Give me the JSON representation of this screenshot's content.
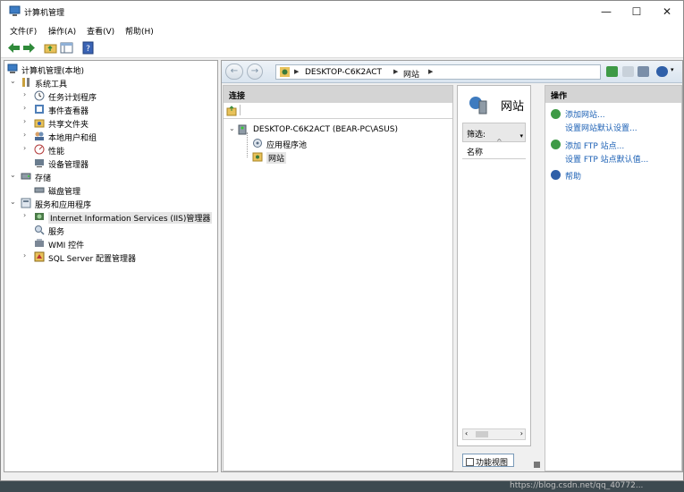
{
  "window": {
    "title": "计算机管理",
    "controls": [
      "—",
      "☐",
      "✕"
    ]
  },
  "menu": [
    "文件(F)",
    "操作(A)",
    "查看(V)",
    "帮助(H)"
  ],
  "tree": [
    {
      "label": "计算机管理(本地)"
    },
    {
      "label": "系统工具"
    },
    {
      "label": "任务计划程序"
    },
    {
      "label": "事件查看器"
    },
    {
      "label": "共享文件夹"
    },
    {
      "label": "本地用户和组"
    },
    {
      "label": "性能"
    },
    {
      "label": "设备管理器"
    },
    {
      "label": "存储"
    },
    {
      "label": "磁盘管理"
    },
    {
      "label": "服务和应用程序"
    },
    {
      "label": "Internet Information Services (IIS)管理器"
    },
    {
      "label": "服务"
    },
    {
      "label": "WMI 控件"
    },
    {
      "label": "SQL Server 配置管理器"
    }
  ],
  "iis": {
    "address": {
      "host": "DESKTOP-C6K2ACT",
      "section": "网站"
    },
    "connections": {
      "title": "连接",
      "server": "DESKTOP-C6K2ACT (BEAR-PC\\ASUS)",
      "app_pools": "应用程序池",
      "sites": "网站"
    },
    "center": {
      "heading": "网站",
      "filter_label": "筛选:",
      "column_name": "名称",
      "feature_view": "功能视图"
    },
    "actions": {
      "title": "操作",
      "add_site": "添加网站...",
      "site_defaults": "设置网站默认设置...",
      "add_ftp": "添加 FTP 站点...",
      "ftp_defaults": "设置 FTP 站点默认值...",
      "help": "帮助"
    }
  },
  "taskbar": {
    "left_text": "",
    "mid_text": "",
    "watermark": "https://blog.csdn.net/qq_40772..."
  },
  "colors": {
    "link": "#1a5fb4",
    "header_gray": "#d4d4d4",
    "selection": "#e5e5e5"
  }
}
